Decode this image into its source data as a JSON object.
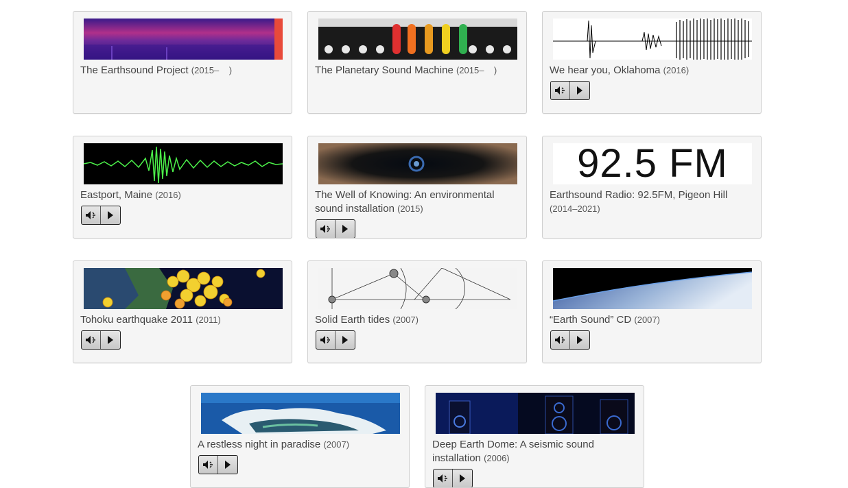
{
  "cards": [
    {
      "title": "The Earthsound Project",
      "year": "(2015–    )",
      "thumb": "purple-spectrogram-image"
    },
    {
      "title": "The Planetary Sound Machine",
      "year": "(2015–    )",
      "thumb": "modular-synth-patch-cables-image"
    },
    {
      "title": "We hear you, Oklahoma",
      "year": "(2016)",
      "thumb": "seismogram-waveform-image"
    },
    {
      "title": "Eastport, Maine",
      "year": "(2016)",
      "thumb": "green-waveform-image"
    },
    {
      "title": "The Well of Knowing: An environmental sound installation",
      "year": "(2015)",
      "thumb": "well-shaft-image"
    },
    {
      "title": "Earthsound Radio: 92.5FM, Pigeon Hill",
      "year": "(2014–2021)",
      "thumb": "radio-frequency-logo-image",
      "logo_text": "92.5 FM"
    },
    {
      "title": "Tohoku earthquake 2011",
      "year": "(2011)",
      "thumb": "earthquake-map-image"
    },
    {
      "title": "Solid Earth tides",
      "year": "(2007)",
      "thumb": "tide-geometry-diagram-image"
    },
    {
      "title": "“Earth Sound” CD",
      "year": "(2007)",
      "thumb": "earth-from-space-image"
    },
    {
      "title": "A restless night in paradise",
      "year": "(2007)",
      "thumb": "satellite-island-image"
    },
    {
      "title": "Deep Earth Dome: A seismic sound installation",
      "year": "(2006)",
      "thumb": "speakers-dark-room-image"
    }
  ],
  "icons": {
    "mute": "speaker-mute-icon",
    "play": "play-icon"
  },
  "colors": {
    "card_bg": "#f5f5f5",
    "card_border": "#cfcfcf",
    "text": "#444444"
  }
}
